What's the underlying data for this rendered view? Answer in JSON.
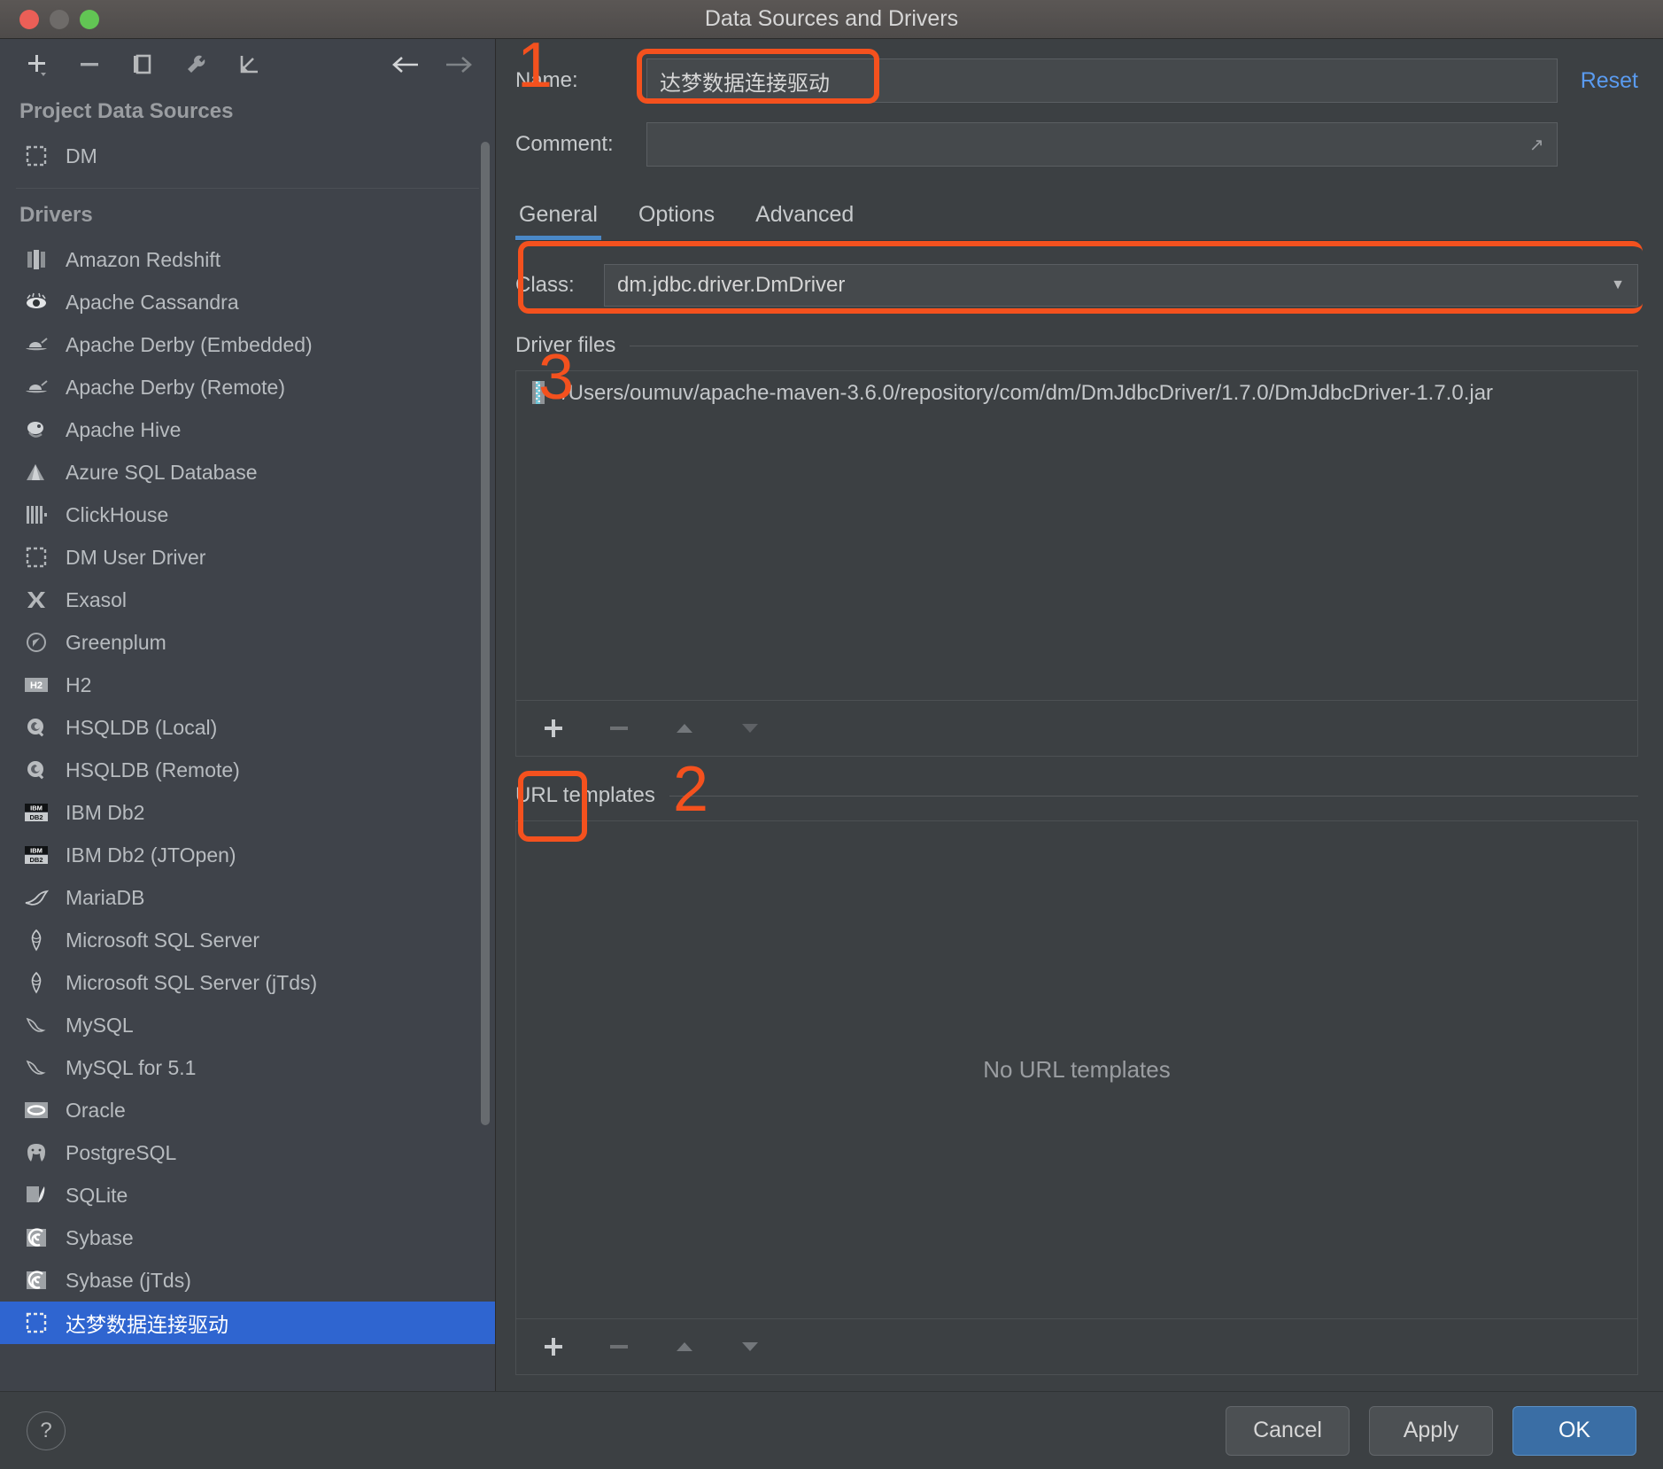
{
  "window": {
    "title": "Data Sources and Drivers",
    "traffic_lights": [
      "close",
      "minimize",
      "zoom"
    ]
  },
  "left_panel": {
    "toolbar": [
      {
        "name": "add-icon",
        "glyph": "+"
      },
      {
        "name": "remove-icon",
        "glyph": "−"
      },
      {
        "name": "copy-icon",
        "glyph": "copy"
      },
      {
        "name": "wrench-icon",
        "glyph": "wrench"
      },
      {
        "name": "import-icon",
        "glyph": "import"
      },
      {
        "name": "back-arrow-icon",
        "glyph": "←"
      },
      {
        "name": "forward-arrow-icon",
        "glyph": "→"
      }
    ],
    "project_data_sources_header": "Project Data Sources",
    "project_data_sources": [
      {
        "label": "DM",
        "icon": "dm-icon"
      }
    ],
    "drivers_header": "Drivers",
    "drivers": [
      {
        "label": "Amazon Redshift",
        "icon": "redshift-icon"
      },
      {
        "label": "Apache Cassandra",
        "icon": "cassandra-icon"
      },
      {
        "label": "Apache Derby (Embedded)",
        "icon": "derby-icon"
      },
      {
        "label": "Apache Derby (Remote)",
        "icon": "derby-icon"
      },
      {
        "label": "Apache Hive",
        "icon": "hive-icon"
      },
      {
        "label": "Azure SQL Database",
        "icon": "azure-icon"
      },
      {
        "label": "ClickHouse",
        "icon": "clickhouse-icon"
      },
      {
        "label": "DM User Driver",
        "icon": "dm-icon"
      },
      {
        "label": "Exasol",
        "icon": "exasol-icon"
      },
      {
        "label": "Greenplum",
        "icon": "greenplum-icon"
      },
      {
        "label": "H2",
        "icon": "h2-icon"
      },
      {
        "label": "HSQLDB (Local)",
        "icon": "hsqldb-icon"
      },
      {
        "label": "HSQLDB (Remote)",
        "icon": "hsqldb-icon"
      },
      {
        "label": "IBM Db2",
        "icon": "db2-icon"
      },
      {
        "label": "IBM Db2 (JTOpen)",
        "icon": "db2-icon"
      },
      {
        "label": "MariaDB",
        "icon": "mariadb-icon"
      },
      {
        "label": "Microsoft SQL Server",
        "icon": "mssql-icon"
      },
      {
        "label": "Microsoft SQL Server (jTds)",
        "icon": "mssql-icon"
      },
      {
        "label": "MySQL",
        "icon": "mysql-icon"
      },
      {
        "label": "MySQL for 5.1",
        "icon": "mysql-icon"
      },
      {
        "label": "Oracle",
        "icon": "oracle-icon"
      },
      {
        "label": "PostgreSQL",
        "icon": "postgres-icon"
      },
      {
        "label": "SQLite",
        "icon": "sqlite-icon"
      },
      {
        "label": "Sybase",
        "icon": "sybase-icon"
      },
      {
        "label": "Sybase (jTds)",
        "icon": "sybase-icon"
      },
      {
        "label": "达梦数据连接驱动",
        "icon": "dm-icon",
        "selected": true
      }
    ]
  },
  "detail": {
    "name_label": "Name:",
    "name_value": "达梦数据连接驱动",
    "comment_label": "Comment:",
    "comment_value": "",
    "reset_label": "Reset",
    "tabs": [
      {
        "label": "General",
        "active": true
      },
      {
        "label": "Options",
        "active": false
      },
      {
        "label": "Advanced",
        "active": false
      }
    ],
    "class_label": "Class:",
    "class_value": "dm.jdbc.driver.DmDriver",
    "driver_files_title": "Driver files",
    "driver_files": [
      "/Users/oumuv/apache-maven-3.6.0/repository/com/dm/DmJdbcDriver/1.7.0/DmJdbcDriver-1.7.0.jar"
    ],
    "files_toolbar": [
      {
        "name": "add-file-button",
        "glyph": "+",
        "enabled": true
      },
      {
        "name": "remove-file-button",
        "glyph": "−",
        "enabled": false
      },
      {
        "name": "move-up-button",
        "glyph": "▲",
        "enabled": false
      },
      {
        "name": "move-down-button",
        "glyph": "▼",
        "enabled": false
      }
    ],
    "url_templates_title": "URL templates",
    "url_templates_empty": "No URL templates",
    "url_toolbar": [
      {
        "name": "add-url-button",
        "glyph": "+",
        "enabled": true
      },
      {
        "name": "remove-url-button",
        "glyph": "−",
        "enabled": false
      },
      {
        "name": "url-move-up-button",
        "glyph": "▲",
        "enabled": false
      },
      {
        "name": "url-move-down-button",
        "glyph": "▼",
        "enabled": false
      }
    ]
  },
  "footer": {
    "help_label": "?",
    "cancel_label": "Cancel",
    "apply_label": "Apply",
    "ok_label": "OK"
  },
  "annotations": [
    {
      "number": "1",
      "target": "name-field"
    },
    {
      "number": "2",
      "target": "add-file-button"
    },
    {
      "number": "3",
      "target": "driver-files-section"
    }
  ],
  "colors": {
    "annotation": "#f4511e",
    "selection": "#2f65d0",
    "link": "#5a9bf0",
    "primary_button": "#3a6ea5",
    "tab_underline": "#4a88c7"
  }
}
